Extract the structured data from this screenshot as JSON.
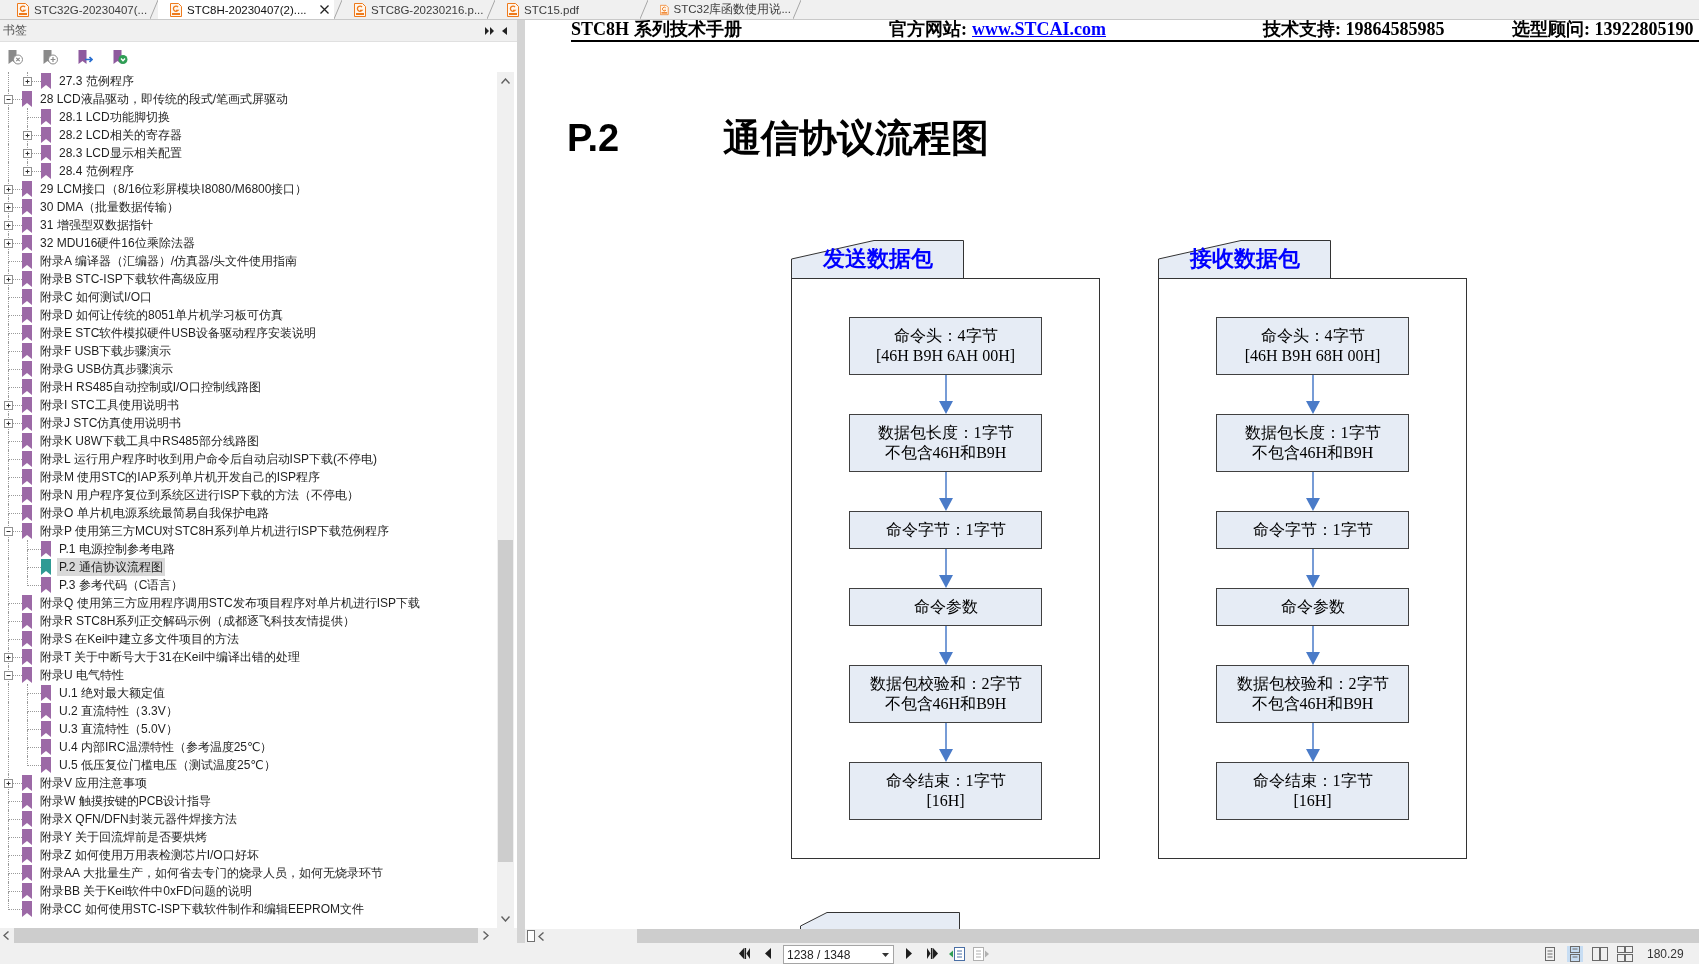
{
  "tabs": [
    {
      "label": "STC32G-20230407(...",
      "selected": false
    },
    {
      "label": "STC8H-20230407(2)....",
      "selected": true
    },
    {
      "label": "STC8G-20230216.p...",
      "selected": false
    },
    {
      "label": "STC15.pdf",
      "selected": false
    },
    {
      "label": "STC32库函数使用说...",
      "selected": false
    }
  ],
  "sidebar": {
    "title": "书签",
    "tools": [
      {
        "kind": "delete",
        "disabled": true
      },
      {
        "kind": "add",
        "disabled": true
      },
      {
        "kind": "goto",
        "disabled": false
      },
      {
        "kind": "expand",
        "disabled": false
      }
    ],
    "bookmarks": {
      "continued_children": [
        {
          "label": "27.3 范例程序",
          "kind": "branch",
          "expanded": false,
          "selected": false
        }
      ],
      "items": [
        {
          "label": "28 LCD液晶驱动，即传统的段式/笔画式屏驱动",
          "kind": "branch",
          "expanded": true,
          "selected": false,
          "children": [
            {
              "label": "28.1 LCD功能脚切换",
              "kind": "leaf",
              "selected": false
            },
            {
              "label": "28.2 LCD相关的寄存器",
              "kind": "branch",
              "expanded": false,
              "selected": false
            },
            {
              "label": "28.3 LCD显示相关配置",
              "kind": "branch",
              "expanded": false,
              "selected": false
            },
            {
              "label": "28.4 范例程序",
              "kind": "branch",
              "expanded": false,
              "selected": false
            }
          ]
        },
        {
          "label": "29 LCM接口（8/16位彩屏模块I8080/M6800接口）",
          "kind": "branch",
          "expanded": false,
          "selected": false
        },
        {
          "label": "30 DMA（批量数据传输）",
          "kind": "branch",
          "expanded": false,
          "selected": false
        },
        {
          "label": "31 增强型双数据指针",
          "kind": "branch",
          "expanded": false,
          "selected": false
        },
        {
          "label": "32 MDU16硬件16位乘除法器",
          "kind": "branch",
          "expanded": false,
          "selected": false
        },
        {
          "label": "附录A 编译器（汇编器）/仿真器/头文件使用指南",
          "kind": "leaf",
          "selected": false
        },
        {
          "label": "附录B STC-ISP下载软件高级应用",
          "kind": "branch",
          "expanded": false,
          "selected": false
        },
        {
          "label": "附录C 如何测试I/O口",
          "kind": "leaf",
          "selected": false
        },
        {
          "label": "附录D 如何让传统的8051单片机学习板可仿真",
          "kind": "leaf",
          "selected": false
        },
        {
          "label": "附录E STC软件模拟硬件USB设备驱动程序安装说明",
          "kind": "leaf",
          "selected": false
        },
        {
          "label": "附录F USB下载步骤演示",
          "kind": "leaf",
          "selected": false
        },
        {
          "label": "附录G USB仿真步骤演示",
          "kind": "leaf",
          "selected": false
        },
        {
          "label": "附录H RS485自动控制或I/O口控制线路图",
          "kind": "leaf",
          "selected": false
        },
        {
          "label": "附录I STC工具使用说明书",
          "kind": "branch",
          "expanded": false,
          "selected": false
        },
        {
          "label": "附录J STC仿真使用说明书",
          "kind": "branch",
          "expanded": false,
          "selected": false
        },
        {
          "label": "附录K U8W下载工具中RS485部分线路图",
          "kind": "leaf",
          "selected": false
        },
        {
          "label": "附录L 运行用户程序时收到用户命令后自动启动ISP下载(不停电)",
          "kind": "leaf",
          "selected": false
        },
        {
          "label": "附录M 使用STC的IAP系列单片机开发自己的ISP程序",
          "kind": "leaf",
          "selected": false
        },
        {
          "label": "附录N 用户程序复位到系统区进行ISP下载的方法（不停电）",
          "kind": "leaf",
          "selected": false
        },
        {
          "label": "附录O 单片机电源系统最简易自我保护电路",
          "kind": "leaf",
          "selected": false
        },
        {
          "label": "附录P 使用第三方MCU对STC8H系列单片机进行ISP下载范例程序",
          "kind": "branch",
          "expanded": true,
          "selected": false,
          "children": [
            {
              "label": "P.1 电源控制参考电路",
              "kind": "leaf",
              "selected": false
            },
            {
              "label": "P.2 通信协议流程图",
              "kind": "leaf",
              "selected": true
            },
            {
              "label": "P.3 参考代码（C语言）",
              "kind": "leaf",
              "selected": false
            }
          ]
        },
        {
          "label": "附录Q 使用第三方应用程序调用STC发布项目程序对单片机进行ISP下载",
          "kind": "leaf",
          "selected": false
        },
        {
          "label": "附录R STC8H系列正交解码示例（成都逐飞科技友情提供）",
          "kind": "leaf",
          "selected": false
        },
        {
          "label": "附录S 在Keil中建立多文件项目的方法",
          "kind": "leaf",
          "selected": false
        },
        {
          "label": "附录T 关于中断号大于31在Keil中编译出错的处理",
          "kind": "branch",
          "expanded": false,
          "selected": false
        },
        {
          "label": "附录U 电气特性",
          "kind": "branch",
          "expanded": true,
          "selected": false,
          "children": [
            {
              "label": "U.1 绝对最大额定值",
              "kind": "leaf",
              "selected": false
            },
            {
              "label": "U.2 直流特性（3.3V）",
              "kind": "leaf",
              "selected": false
            },
            {
              "label": "U.3 直流特性（5.0V）",
              "kind": "leaf",
              "selected": false
            },
            {
              "label": "U.4 内部IRC温漂特性（参考温度25℃）",
              "kind": "leaf",
              "selected": false
            },
            {
              "label": "U.5 低压复位门槛电压（测试温度25℃）",
              "kind": "leaf",
              "selected": false
            }
          ]
        },
        {
          "label": "附录V 应用注意事项",
          "kind": "branch",
          "expanded": false,
          "selected": false
        },
        {
          "label": "附录W 触摸按键的PCB设计指导",
          "kind": "leaf",
          "selected": false
        },
        {
          "label": "附录X QFN/DFN封装元器件焊接方法",
          "kind": "leaf",
          "selected": false
        },
        {
          "label": "附录Y 关于回流焊前是否要烘烤",
          "kind": "leaf",
          "selected": false
        },
        {
          "label": "附录Z 如何使用万用表检测芯片I/O口好坏",
          "kind": "leaf",
          "selected": false
        },
        {
          "label": "附录AA 大批量生产，如何省去专门的烧录人员，如何无烧录环节",
          "kind": "leaf",
          "selected": false
        },
        {
          "label": "附录BB 关于Keil软件中0xFD问题的说明",
          "kind": "leaf",
          "selected": false
        },
        {
          "label": "附录CC 如何使用STC-ISP下载软件制作和编辑EEPROM文件",
          "kind": "leaf",
          "selected": false
        }
      ]
    }
  },
  "document": {
    "header": {
      "title": "STC8H 系列技术手册",
      "website_label": "官方网站:",
      "website": "www.STCAI.com",
      "support": "技术支持: 19864585985",
      "advisor": "选型顾问: 13922805190"
    },
    "section": {
      "number": "P.2",
      "title": "通信协议流程图"
    },
    "flowchart": {
      "groups": [
        {
          "title": "发送数据包",
          "steps": [
            {
              "lines": [
                "命令头：4字节",
                "[46H B9H 6AH 00H]"
              ]
            },
            {
              "lines": [
                "数据包长度：1字节",
                "不包含46H和B9H"
              ]
            },
            {
              "lines": [
                "命令字节：1字节"
              ]
            },
            {
              "lines": [
                "命令参数"
              ]
            },
            {
              "lines": [
                "数据包校验和：2字节",
                "不包含46H和B9H"
              ]
            },
            {
              "lines": [
                "命令结束：1字节",
                "[16H]"
              ]
            }
          ]
        },
        {
          "title": "接收数据包",
          "steps": [
            {
              "lines": [
                "命令头：4字节",
                "[46H B9H 68H 00H]"
              ]
            },
            {
              "lines": [
                "数据包长度：1字节",
                "不包含46H和B9H"
              ]
            },
            {
              "lines": [
                "命令字节：1字节"
              ]
            },
            {
              "lines": [
                "命令参数"
              ]
            },
            {
              "lines": [
                "数据包校验和：2字节",
                "不包含46H和B9H"
              ]
            },
            {
              "lines": [
                "命令结束：1字节",
                "[16H]"
              ]
            }
          ]
        }
      ]
    }
  },
  "status_bar": {
    "navigation": [
      {
        "kind": "first",
        "disabled": false
      },
      {
        "kind": "previous",
        "disabled": false
      },
      {
        "kind": "page_field",
        "value": "1238 / 1348"
      },
      {
        "kind": "next",
        "disabled": false
      },
      {
        "kind": "last",
        "disabled": false
      },
      {
        "kind": "back_view",
        "disabled": false
      },
      {
        "kind": "forward_view",
        "disabled": true
      }
    ],
    "view_modes": [
      {
        "kind": "single",
        "selected": false
      },
      {
        "kind": "continuous",
        "selected": true
      },
      {
        "kind": "facing",
        "selected": false
      },
      {
        "kind": "continuous_facing",
        "selected": false
      }
    ],
    "zoom": "180.29"
  }
}
